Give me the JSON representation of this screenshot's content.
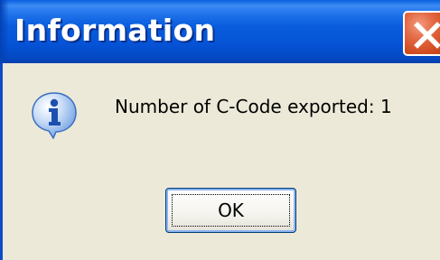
{
  "dialog": {
    "title": "Information",
    "message": "Number of C-Code exported: 1",
    "ok_label": "OK"
  },
  "icons": {
    "close": "close-icon",
    "info": "information-icon"
  },
  "colors": {
    "titlebar_blue": "#0553d6",
    "close_red": "#d24c22",
    "dialog_background": "#ece9d8",
    "info_blue": "#2a6fd6"
  }
}
